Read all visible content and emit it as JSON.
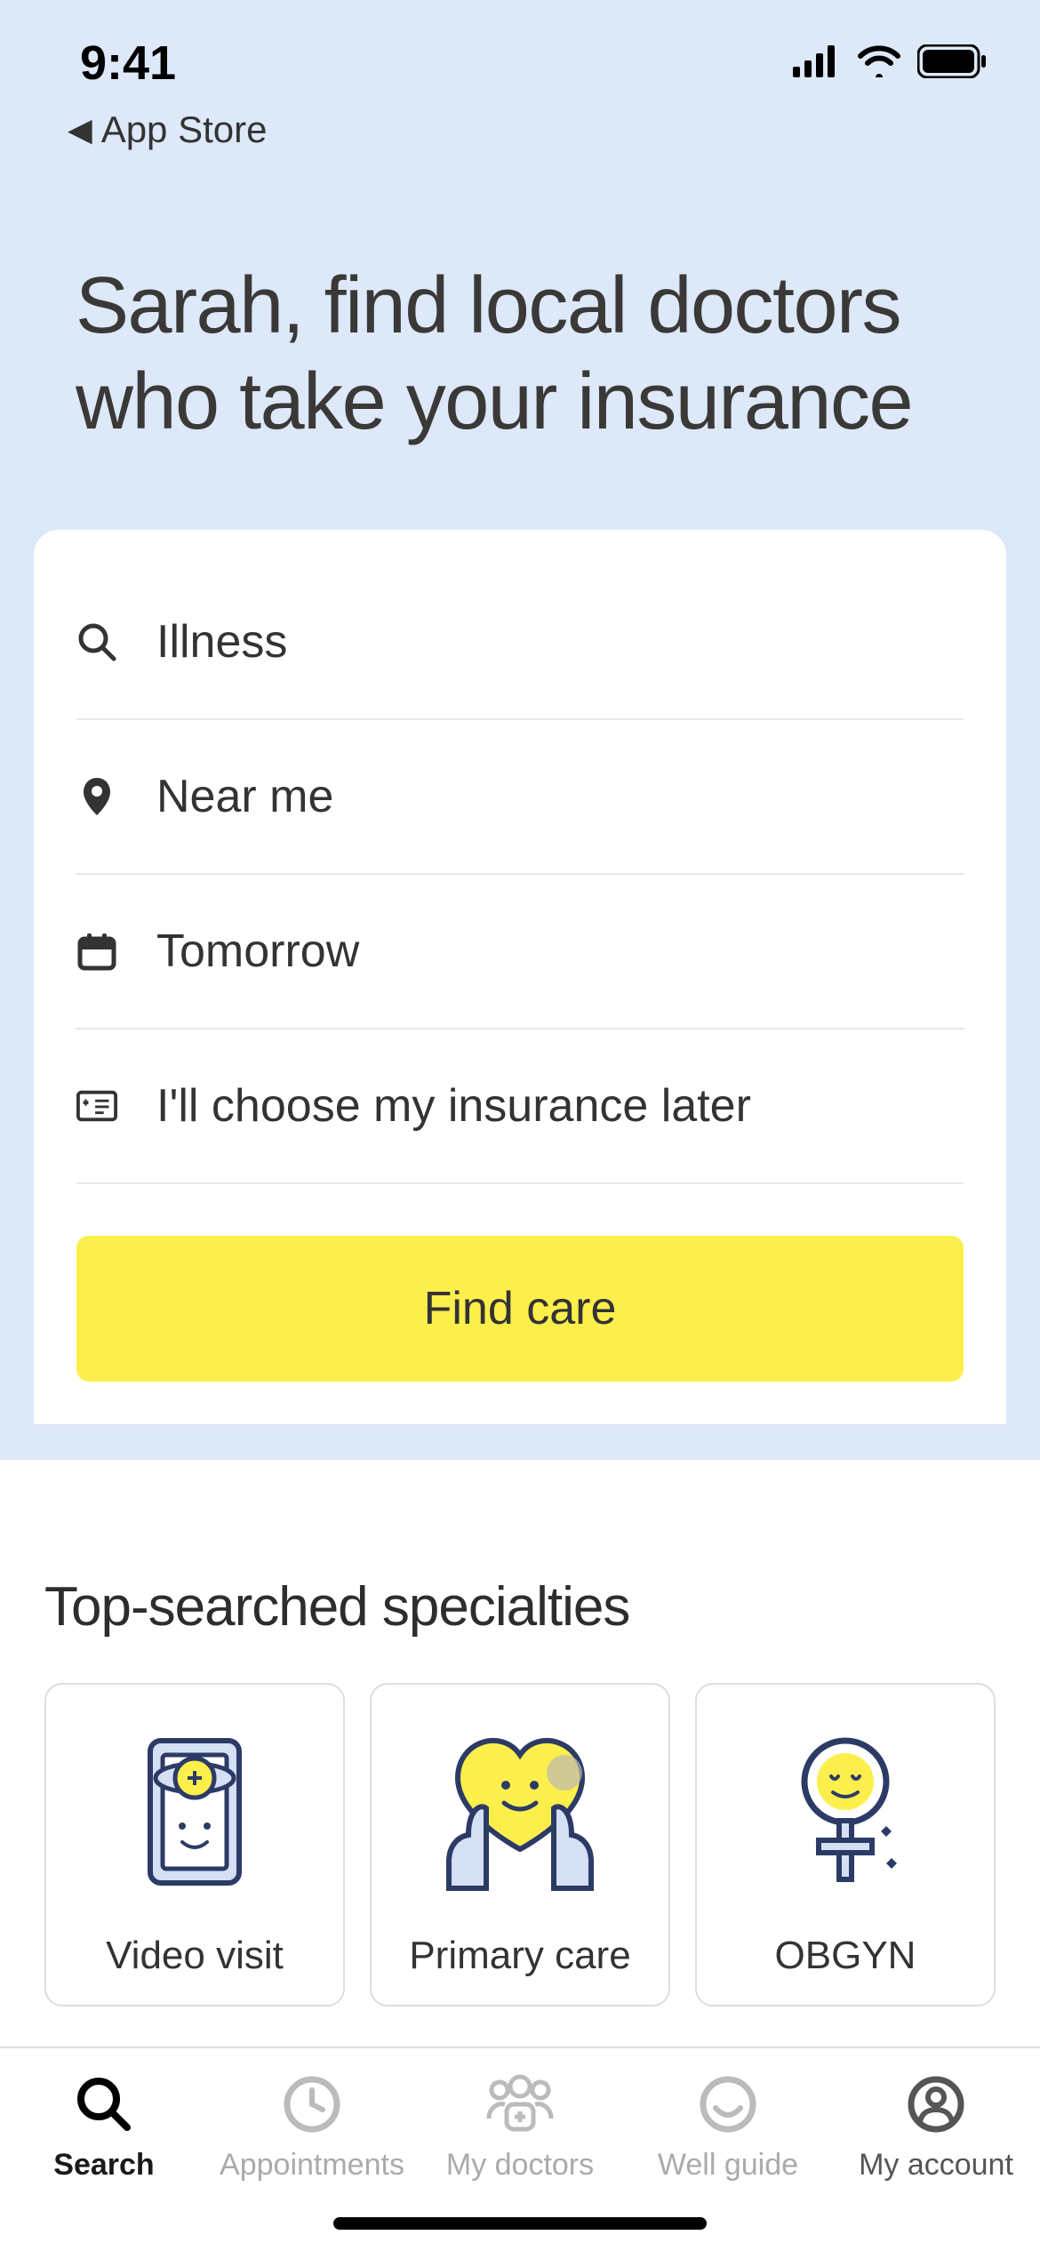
{
  "status_bar": {
    "time": "9:41",
    "back_link": "App Store"
  },
  "hero": {
    "title": "Sarah, find local doctors who take your insurance"
  },
  "search": {
    "query": "Illness",
    "location": "Near me",
    "date": "Tomorrow",
    "insurance": "I'll choose my insurance later",
    "button": "Find care"
  },
  "specialties": {
    "heading": "Top-searched specialties",
    "items": [
      {
        "label": "Video visit"
      },
      {
        "label": "Primary care"
      },
      {
        "label": "OBGYN"
      }
    ]
  },
  "tabs": [
    {
      "label": "Search",
      "active": true
    },
    {
      "label": "Appointments",
      "active": false
    },
    {
      "label": "My doctors",
      "active": false
    },
    {
      "label": "Well guide",
      "active": false
    },
    {
      "label": "My account",
      "active": false
    }
  ],
  "colors": {
    "hero_bg": "#dde8f9",
    "accent_yellow": "#fdef4b"
  }
}
